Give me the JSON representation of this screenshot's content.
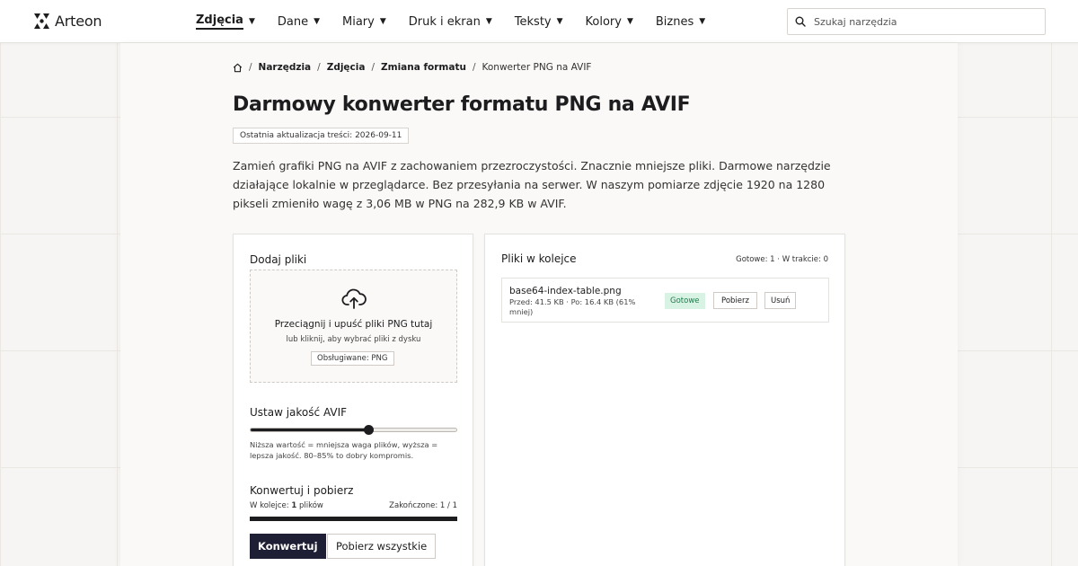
{
  "header": {
    "brand": "Arteon",
    "nav": [
      {
        "label": "Zdjęcia",
        "active": true
      },
      {
        "label": "Dane"
      },
      {
        "label": "Miary"
      },
      {
        "label": "Druk i ekran"
      },
      {
        "label": "Teksty"
      },
      {
        "label": "Kolory"
      },
      {
        "label": "Biznes"
      }
    ],
    "caret": "▼",
    "search_placeholder": "Szukaj narzędzia"
  },
  "breadcrumb": {
    "items": [
      "Narzędzia",
      "Zdjęcia",
      "Zmiana formatu"
    ],
    "current": "Konwerter PNG na AVIF",
    "separator": "/"
  },
  "page": {
    "title": "Darmowy konwerter formatu PNG na AVIF",
    "updated": "Ostatnia aktualizacja treści: 2026-09-11",
    "intro": "Zamień grafiki PNG na AVIF z zachowaniem przezroczystości. Znacznie mniejsze pliki. Darmowe narzędzie działające lokalnie w przeglądarce. Bez przesyłania na serwer. W naszym pomiarze zdjęcie 1920 na 1280 pikseli zmieniło wagę z 3,06 MB w PNG na 282,9 KB w AVIF."
  },
  "upload": {
    "heading": "Dodaj pliki",
    "drop_main": "Przeciągnij i upuść pliki PNG tutaj",
    "drop_sub": "lub kliknij, aby wybrać pliki z dysku",
    "supported": "Obsługiwane: PNG"
  },
  "quality": {
    "heading": "Ustaw jakość AVIF",
    "value_fraction": 0.57,
    "hint": "Niższa wartość = mniejsza waga plików, wyższa = lepsza jakość. 80–85% to dobry kompromis."
  },
  "convert": {
    "heading": "Konwertuj i pobierz",
    "queue_prefix": "W kolejce: ",
    "queue_count": "1",
    "queue_suffix": " plików",
    "finished": "Zakończone: 1 / 1",
    "progress_fraction": 1.0,
    "convert_label": "Konwertuj",
    "download_all_label": "Pobierz wszystkie"
  },
  "queue": {
    "heading": "Pliki w kolejce",
    "status": "Gotowe: 1 · W trakcie: 0",
    "files": [
      {
        "name": "base64-index-table.png",
        "meta": "Przed: 41.5 KB · Po: 16.4 KB (61% mniej)",
        "status": "Gotowe",
        "download": "Pobierz",
        "remove": "Usuń"
      }
    ]
  },
  "colors": {
    "primary_button": "#1e1e34",
    "success_bg": "#d8f3e4",
    "success_text": "#1f7a4c"
  }
}
